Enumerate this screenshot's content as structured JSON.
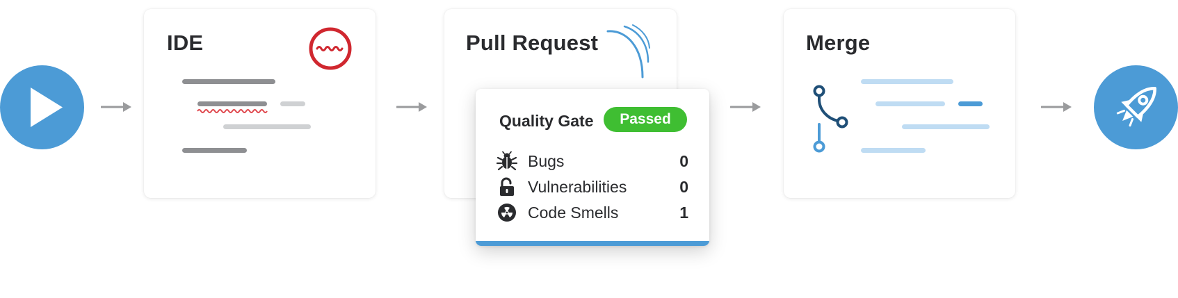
{
  "pipeline": {
    "start": {
      "icon": "play-icon"
    },
    "ide": {
      "title": "IDE",
      "icon": "squiggle-badge-icon"
    },
    "pull_request": {
      "title": "Pull Request",
      "icon": "signal-waves-icon"
    },
    "merge": {
      "title": "Merge",
      "icon": "branch-merge-icon"
    },
    "release": {
      "icon": "rocket-icon"
    },
    "arrow_icon": "right-arrow-icon"
  },
  "quality_gate": {
    "title": "Quality Gate",
    "status": "Passed",
    "metrics": [
      {
        "icon": "bug-icon",
        "label": "Bugs",
        "value": "0"
      },
      {
        "icon": "unlocked-padlock-icon",
        "label": "Vulnerabilities",
        "value": "0"
      },
      {
        "icon": "radiation-icon",
        "label": "Code Smells",
        "value": "1"
      }
    ]
  },
  "colors": {
    "brand_blue": "#4c9bd6",
    "dark_blue": "#1f4f77",
    "light_blue": "#bfdcf3",
    "alert_red": "#d0272f",
    "passed_green": "#3fbe32",
    "arrow_grey": "#9a9b9d",
    "code_grey": "#8e8f92",
    "code_light_grey": "#cfd1d3"
  }
}
